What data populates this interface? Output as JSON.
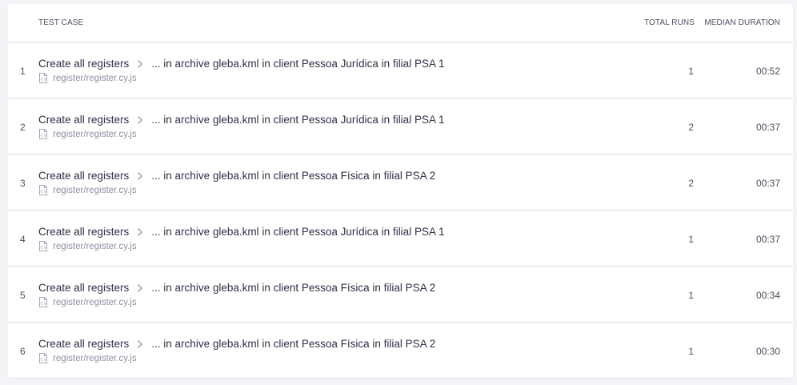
{
  "table": {
    "headers": {
      "test_case": "TEST CASE",
      "total_runs": "TOTAL RUNS",
      "median_duration": "MEDIAN DURATION"
    },
    "rows": [
      {
        "index": "1",
        "suite": "Create all registers",
        "test": "... in archive gleba.kml in client Pessoa Jurídica in filial PSA 1",
        "file": "register/register.cy.js",
        "runs": "1",
        "duration": "00:52"
      },
      {
        "index": "2",
        "suite": "Create all registers",
        "test": "... in archive gleba.kml in client Pessoa Jurídica in filial PSA 1",
        "file": "register/register.cy.js",
        "runs": "2",
        "duration": "00:37"
      },
      {
        "index": "3",
        "suite": "Create all registers",
        "test": "... in archive gleba.kml in client Pessoa Física in filial PSA 2",
        "file": "register/register.cy.js",
        "runs": "2",
        "duration": "00:37"
      },
      {
        "index": "4",
        "suite": "Create all registers",
        "test": "... in archive gleba.kml in client Pessoa Jurídica in filial PSA 1",
        "file": "register/register.cy.js",
        "runs": "1",
        "duration": "00:37"
      },
      {
        "index": "5",
        "suite": "Create all registers",
        "test": "... in archive gleba.kml in client Pessoa Física in filial PSA 2",
        "file": "register/register.cy.js",
        "runs": "1",
        "duration": "00:34"
      },
      {
        "index": "6",
        "suite": "Create all registers",
        "test": "... in archive gleba.kml in client Pessoa Física in filial PSA 2",
        "file": "register/register.cy.js",
        "runs": "1",
        "duration": "00:30"
      }
    ]
  },
  "icons": {
    "breadcrumb_separator": "chevron-right-icon",
    "spec_file": "file-code-icon"
  },
  "colors": {
    "text_primary": "#2e3243",
    "text_secondary": "#8d92a3",
    "divider": "#d9dce4"
  }
}
